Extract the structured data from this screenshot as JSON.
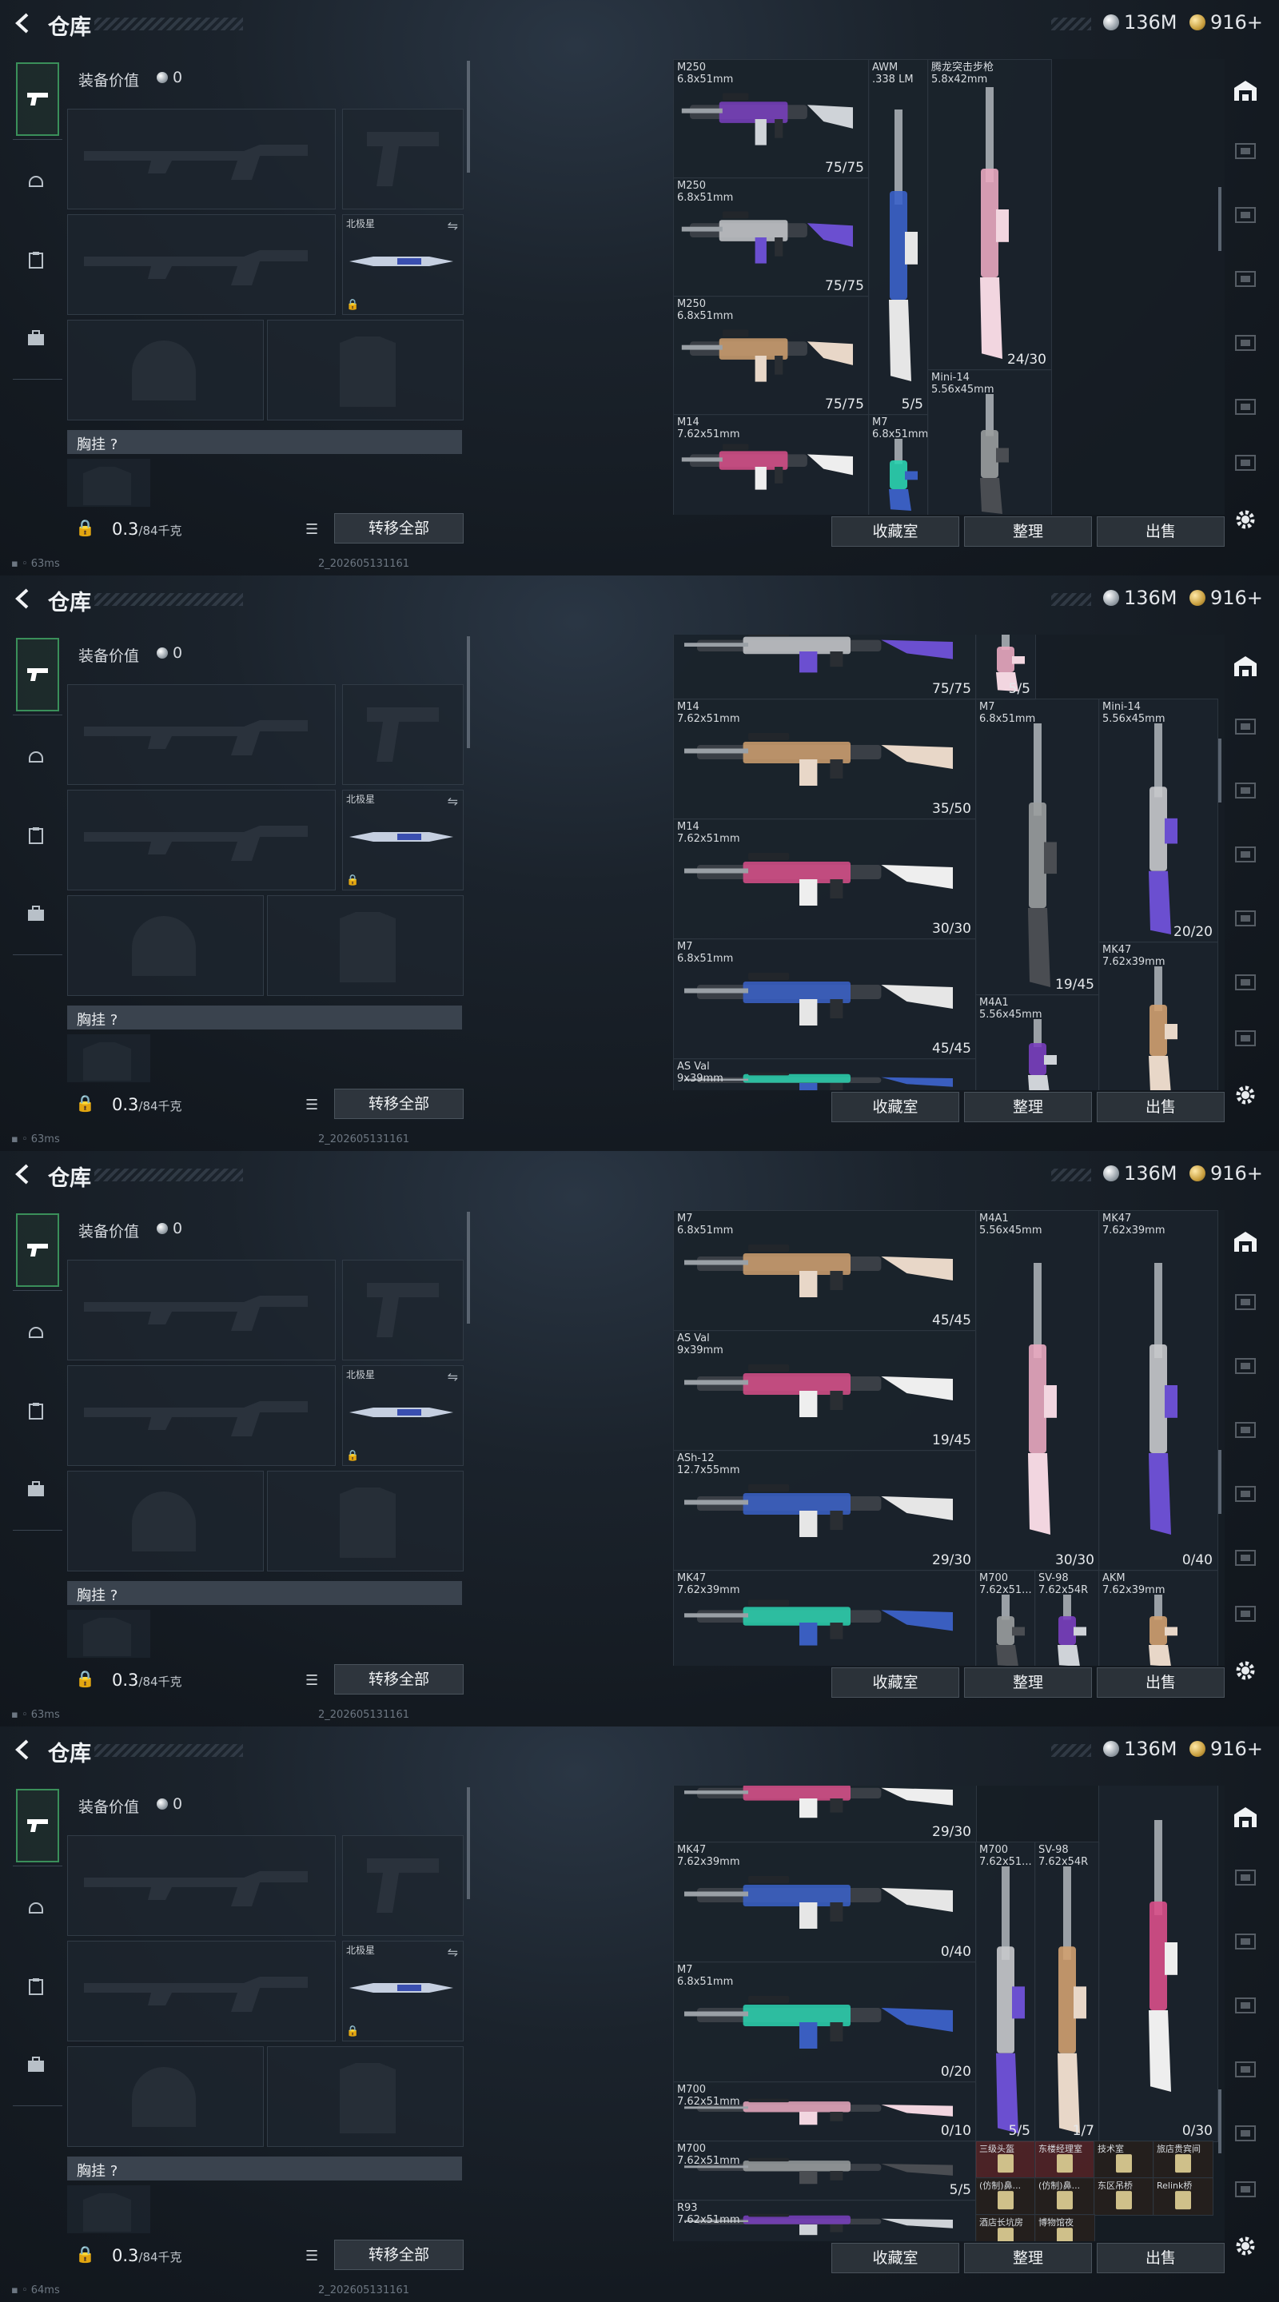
{
  "header": {
    "title": "仓库",
    "silver": "136M",
    "gold": "916+"
  },
  "loadout": {
    "equip_value_label": "装备价值",
    "equip_value": "0",
    "knife_name": "北极星",
    "chest_label": "胸挂 ?",
    "weight": "0.3",
    "weight_cap": "/84千克",
    "transfer_all": "转移全部"
  },
  "grid_buttons": {
    "collection": "收藏室",
    "sort": "整理",
    "sell": "出售"
  },
  "frames": [
    {
      "status": "63ms",
      "build": "2_202605131161",
      "cells": [
        {
          "name": "M250\n6.8x51mm",
          "count": "75/75",
          "gun": "lmg"
        },
        {
          "name": "M250\n6.8x51mm",
          "count": "75/75",
          "gun": "lmg"
        },
        {
          "name": "M250\n6.8x51mm",
          "count": "75/75",
          "gun": "lmg"
        },
        {
          "name": "M14\n7.62x51mm",
          "count": "",
          "gun": "rifle"
        },
        {
          "name": "AWM\n.338 LM",
          "count": "5/5",
          "gun": "vsniper"
        },
        {
          "name": "M7\n6.8x51mm",
          "count": "",
          "gun": "vrifle"
        },
        {
          "name": "腾龙突击步枪\n5.8x42mm",
          "count": "24/30",
          "gun": "vrifle"
        },
        {
          "name": "Mini-14\n5.56x45mm",
          "count": "",
          "gun": "vrifle"
        }
      ]
    },
    {
      "status": "63ms",
      "build": "2_202605131161",
      "cells": [
        {
          "name": "",
          "count": "75/75",
          "gun": "lmg"
        },
        {
          "name": "M14\n7.62x51mm",
          "count": "35/50",
          "gun": "rifle"
        },
        {
          "name": "M14\n7.62x51mm",
          "count": "30/30",
          "gun": "rifle"
        },
        {
          "name": "M7\n6.8x51mm",
          "count": "45/45",
          "gun": "rifle"
        },
        {
          "name": "AS Val\n9x39mm",
          "count": "",
          "gun": "rifle"
        },
        {
          "name": "",
          "count": "5/5",
          "gun": "vsniper"
        },
        {
          "name": "M7\n6.8x51mm",
          "count": "19/45",
          "gun": "vrifle"
        },
        {
          "name": "M4A1\n5.56x45mm",
          "count": "",
          "gun": "vrifle"
        },
        {
          "name": "Mini-14\n5.56x45mm",
          "count": "20/20",
          "gun": "vrifle"
        },
        {
          "name": "MK47\n7.62x39mm",
          "count": "",
          "gun": "vrifle"
        }
      ]
    },
    {
      "status": "63ms",
      "build": "2_202605131161",
      "cells": [
        {
          "name": "M7\n6.8x51mm",
          "count": "45/45",
          "gun": "rifle"
        },
        {
          "name": "AS Val\n9x39mm",
          "count": "19/45",
          "gun": "rifle"
        },
        {
          "name": "ASh-12\n12.7x55mm",
          "count": "29/30",
          "gun": "rifle"
        },
        {
          "name": "MK47\n7.62x39mm",
          "count": "",
          "gun": "rifle"
        },
        {
          "name": "M4A1\n5.56x45mm",
          "count": "30/30",
          "gun": "vrifle"
        },
        {
          "name": "M700\n7.62x51...",
          "count": "",
          "gun": "vsniper"
        },
        {
          "name": "SV-98\n7.62x54R",
          "count": "",
          "gun": "vsniper"
        },
        {
          "name": "MK47\n7.62x39mm",
          "count": "0/40",
          "gun": "vrifle"
        },
        {
          "name": "AKM\n7.62x39mm",
          "count": "",
          "gun": "vrifle"
        }
      ]
    },
    {
      "status": "64ms",
      "build": "2_202605131161",
      "cells": [
        {
          "name": "",
          "count": "29/30",
          "gun": "rifle"
        },
        {
          "name": "MK47\n7.62x39mm",
          "count": "0/40",
          "gun": "rifle"
        },
        {
          "name": "M7\n6.8x51mm",
          "count": "0/20",
          "gun": "rifle"
        },
        {
          "name": "M700\n7.62x51mm",
          "count": "0/10",
          "gun": "rifle"
        },
        {
          "name": "M700\n7.62x51mm",
          "count": "5/5",
          "gun": "rifle"
        },
        {
          "name": "R93\n7.62x51mm",
          "count": "",
          "gun": "rifle"
        },
        {
          "name": "M700\n7.62x51...",
          "count": "5/5",
          "gun": "vsniper"
        },
        {
          "name": "SV-98\n7.62x54R",
          "count": "1/7",
          "gun": "vsniper"
        },
        {
          "name": "AKM\n7.62x39mm",
          "count": "0/30",
          "gun": "vrifle"
        }
      ],
      "items": [
        "三级头盔",
        "东楼经理室",
        "技术室",
        "旅店贵宾间",
        "(仿制)鼻...",
        "(仿制)鼻...",
        "东区吊桥",
        "Relink桥",
        "酒店长坑房",
        "博物馆夜"
      ]
    }
  ],
  "colors": {
    "accent_green": "#3a8f5a",
    "panel": "#1c242d",
    "button": "#2b3239"
  }
}
